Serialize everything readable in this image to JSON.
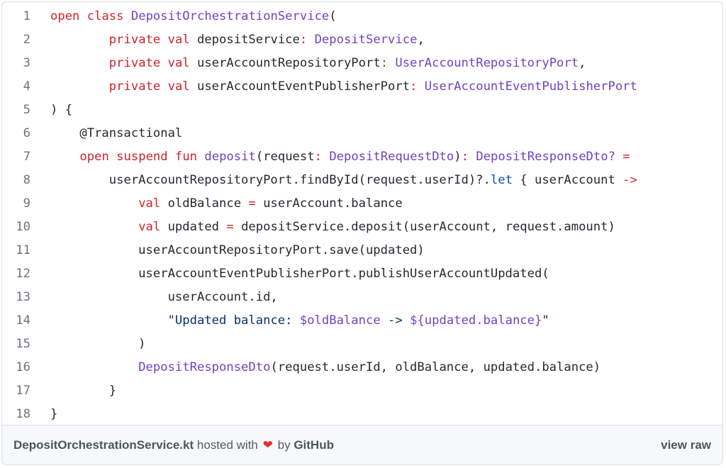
{
  "gist": {
    "lines": [
      {
        "n": "1",
        "tokens": [
          {
            "t": "open",
            "c": "kw"
          },
          {
            "t": " "
          },
          {
            "t": "class",
            "c": "kw"
          },
          {
            "t": " "
          },
          {
            "t": "DepositOrchestrationService",
            "c": "ty"
          },
          {
            "t": "("
          }
        ]
      },
      {
        "n": "2",
        "tokens": [
          {
            "t": "        "
          },
          {
            "t": "private",
            "c": "kw"
          },
          {
            "t": " "
          },
          {
            "t": "val",
            "c": "kw"
          },
          {
            "t": " depositService"
          },
          {
            "t": ":",
            "c": "op"
          },
          {
            "t": " "
          },
          {
            "t": "DepositService",
            "c": "ty"
          },
          {
            "t": ","
          }
        ]
      },
      {
        "n": "3",
        "tokens": [
          {
            "t": "        "
          },
          {
            "t": "private",
            "c": "kw"
          },
          {
            "t": " "
          },
          {
            "t": "val",
            "c": "kw"
          },
          {
            "t": " userAccountRepositoryPort"
          },
          {
            "t": ":",
            "c": "op"
          },
          {
            "t": " "
          },
          {
            "t": "UserAccountRepositoryPort",
            "c": "ty"
          },
          {
            "t": ","
          }
        ]
      },
      {
        "n": "4",
        "tokens": [
          {
            "t": "        "
          },
          {
            "t": "private",
            "c": "kw"
          },
          {
            "t": " "
          },
          {
            "t": "val",
            "c": "kw"
          },
          {
            "t": " userAccountEventPublisherPort"
          },
          {
            "t": ":",
            "c": "op"
          },
          {
            "t": " "
          },
          {
            "t": "UserAccountEventPublisherPort",
            "c": "ty"
          }
        ]
      },
      {
        "n": "5",
        "tokens": [
          {
            "t": ") {"
          }
        ]
      },
      {
        "n": "6",
        "tokens": [
          {
            "t": "    @Transactional"
          }
        ]
      },
      {
        "n": "7",
        "tokens": [
          {
            "t": "    "
          },
          {
            "t": "open",
            "c": "kw"
          },
          {
            "t": " "
          },
          {
            "t": "suspend",
            "c": "kw"
          },
          {
            "t": " "
          },
          {
            "t": "fun",
            "c": "kw"
          },
          {
            "t": " "
          },
          {
            "t": "deposit",
            "c": "fn"
          },
          {
            "t": "(request"
          },
          {
            "t": ":",
            "c": "op"
          },
          {
            "t": " "
          },
          {
            "t": "DepositRequestDto",
            "c": "ty"
          },
          {
            "t": ")"
          },
          {
            "t": ":",
            "c": "op"
          },
          {
            "t": " "
          },
          {
            "t": "DepositResponseDto?",
            "c": "ty"
          },
          {
            "t": " "
          },
          {
            "t": "=",
            "c": "op"
          }
        ]
      },
      {
        "n": "8",
        "tokens": [
          {
            "t": "        userAccountRepositoryPort.findById(request.userId)?."
          },
          {
            "t": "let",
            "c": "bl"
          },
          {
            "t": " { userAccount "
          },
          {
            "t": "->",
            "c": "op"
          }
        ]
      },
      {
        "n": "9",
        "tokens": [
          {
            "t": "            "
          },
          {
            "t": "val",
            "c": "kw"
          },
          {
            "t": " oldBalance "
          },
          {
            "t": "=",
            "c": "op"
          },
          {
            "t": " userAccount.balance"
          }
        ]
      },
      {
        "n": "10",
        "tokens": [
          {
            "t": "            "
          },
          {
            "t": "val",
            "c": "kw"
          },
          {
            "t": " updated "
          },
          {
            "t": "=",
            "c": "op"
          },
          {
            "t": " depositService.deposit(userAccount, request.amount)"
          }
        ]
      },
      {
        "n": "11",
        "tokens": [
          {
            "t": "            userAccountRepositoryPort.save(updated)"
          }
        ]
      },
      {
        "n": "12",
        "tokens": [
          {
            "t": "            userAccountEventPublisherPort.publishUserAccountUpdated("
          }
        ]
      },
      {
        "n": "13",
        "tokens": [
          {
            "t": "                userAccount.id,"
          }
        ]
      },
      {
        "n": "14",
        "tokens": [
          {
            "t": "                "
          },
          {
            "t": "\"Updated balance: ",
            "c": "st"
          },
          {
            "t": "$oldBalance",
            "c": "tp"
          },
          {
            "t": " -> ",
            "c": "st"
          },
          {
            "t": "${updated.balance}",
            "c": "tp"
          },
          {
            "t": "\"",
            "c": "st"
          }
        ]
      },
      {
        "n": "15",
        "tokens": [
          {
            "t": "            )"
          }
        ]
      },
      {
        "n": "16",
        "tokens": [
          {
            "t": "            "
          },
          {
            "t": "DepositResponseDto",
            "c": "ty"
          },
          {
            "t": "(request.userId, oldBalance, updated.balance)"
          }
        ]
      },
      {
        "n": "17",
        "tokens": [
          {
            "t": "        }"
          }
        ]
      },
      {
        "n": "18",
        "tokens": [
          {
            "t": "}"
          }
        ]
      }
    ]
  },
  "footer": {
    "filename": "DepositOrchestrationService.kt",
    "hosted_with": "hosted with",
    "heart_icon": "heart-icon",
    "heart_glyph": "❤",
    "by": "by",
    "github": "GitHub",
    "view_raw": "view raw"
  },
  "colors": {
    "keyword": "#cf222e",
    "type": "#6f42c1",
    "string": "#0a3069",
    "heart": "#e0302f"
  }
}
